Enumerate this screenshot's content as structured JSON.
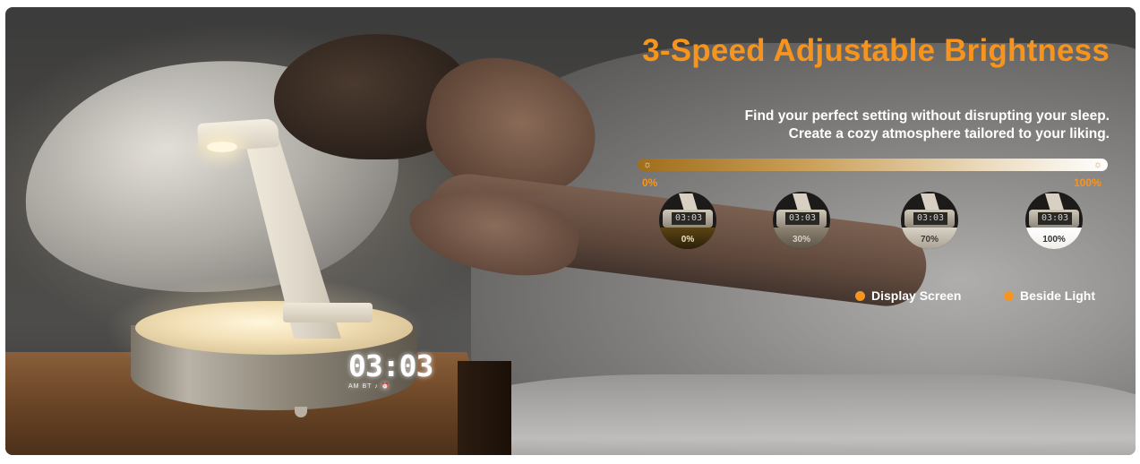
{
  "banner": {
    "title": "3-Speed Adjustable Brightness",
    "subtitle_lines": [
      "Find your perfect setting without disrupting your sleep.",
      "Create a cozy atmosphere tailored to your liking."
    ],
    "accent_color": "#f7941d"
  },
  "slider": {
    "min_label": "0%",
    "max_label": "100%",
    "left_icon": "sun-icon",
    "right_icon": "sun-icon"
  },
  "brightness_levels": [
    {
      "clock": "03:03",
      "label": "0%"
    },
    {
      "clock": "03:03",
      "label": "30%"
    },
    {
      "clock": "03:03",
      "label": "70%"
    },
    {
      "clock": "03:03",
      "label": "100%"
    }
  ],
  "legend": [
    {
      "label": "Display Screen",
      "color": "#f7941d"
    },
    {
      "label": "Beside Light",
      "color": "#f7941d"
    }
  ],
  "lamp_display": {
    "time": "03:03",
    "indicators": "AM  BT  ♪  ⏰"
  }
}
